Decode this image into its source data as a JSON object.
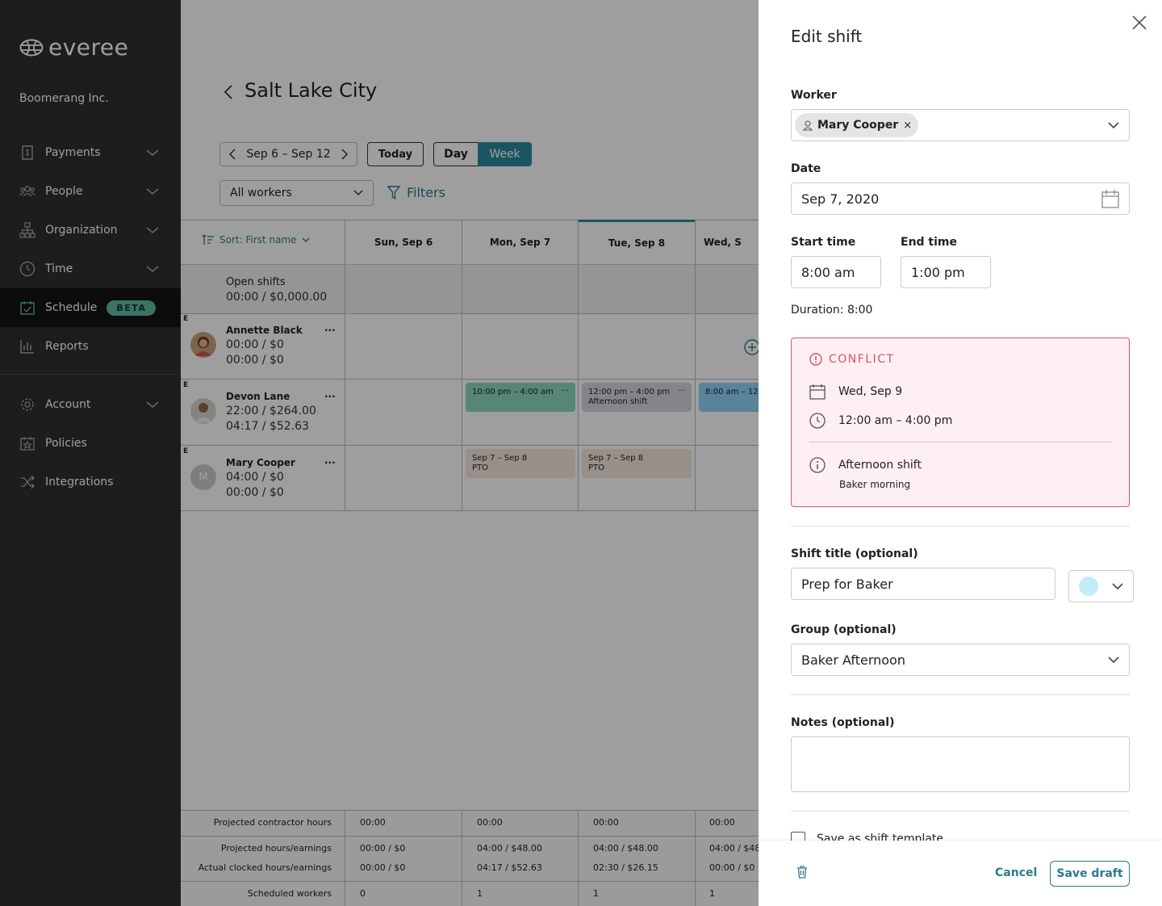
{
  "brand": {
    "name": "everee"
  },
  "sidebar": {
    "company": "Boomerang Inc.",
    "items": [
      {
        "label": "Payments",
        "icon": "receipt-icon"
      },
      {
        "label": "People",
        "icon": "people-icon"
      },
      {
        "label": "Organization",
        "icon": "org-chart-icon"
      },
      {
        "label": "Time",
        "icon": "clock-icon"
      },
      {
        "label": "Schedule",
        "icon": "calendar-check-icon",
        "badge": "BETA"
      },
      {
        "label": "Reports",
        "icon": "bar-chart-icon"
      },
      {
        "label": "Account",
        "icon": "gear-icon"
      },
      {
        "label": "Policies",
        "icon": "policy-icon"
      },
      {
        "label": "Integrations",
        "icon": "shuffle-icon"
      }
    ]
  },
  "page": {
    "title": "Salt Lake City",
    "date_range": "Sep 6 – Sep 12",
    "today": "Today",
    "day": "Day",
    "week": "Week",
    "workers_select": "All workers",
    "filters": "Filters",
    "sort": "Sort: First name"
  },
  "schedule": {
    "days": [
      "Sun, Sep 6",
      "Mon, Sep 7",
      "Tue, Sep 8",
      "Wed, S"
    ],
    "open_shifts": {
      "label": "Open shifts",
      "value": "00:00 / $0,000.00"
    },
    "rows": [
      {
        "tag": "E",
        "name": "Annette Black",
        "line1": "00:00 / $0",
        "line2": "00:00 / $0",
        "menu": "···"
      },
      {
        "tag": "E",
        "name": "Devon Lane",
        "line1": "22:00 / $264.00",
        "line2": "04:17 / $52.63",
        "menu": "···"
      },
      {
        "tag": "E",
        "name": "Mary Cooper",
        "line1": "04:00 / $0",
        "line2": "00:00 / $0",
        "menu": "···",
        "initial": "M"
      }
    ],
    "shifts": [
      {
        "text": "10:00 pm – 4:00 am",
        "sub": "",
        "menu": "···",
        "color": "#8ad9c1"
      },
      {
        "text": "12:00 pm – 4:00 pm",
        "sub": "Afternoon shift",
        "menu": "···",
        "color": "#d8d6e0"
      },
      {
        "text": "8:00 am – 12:",
        "sub": "",
        "menu": "",
        "color": "#8fd3f5"
      },
      {
        "text": "Sep 7 – Sep 8",
        "sub": "PTO",
        "menu": "",
        "color": "#f6e8dc"
      },
      {
        "text": "Sep 7 – Sep 8",
        "sub": "PTO",
        "menu": "",
        "color": "#f6e8dc"
      }
    ],
    "footer": {
      "projected_contractor": {
        "label": "Projected contractor hours",
        "values": [
          "00:00",
          "00:00",
          "00:00",
          "00:00"
        ]
      },
      "projected": {
        "label": "Projected hours/earnings",
        "values": [
          "00:00 / $0",
          "04:00 / $48.00",
          "04:00 / $48.00",
          "04:00 / $48"
        ]
      },
      "actual": {
        "label": "Actual clocked hours/earnings",
        "values": [
          "00:00 / $0",
          "04:17 / $52.63",
          "02:30 / $26.15",
          "00:00 / $0"
        ]
      },
      "scheduled": {
        "label": "Scheduled workers",
        "values": [
          "0",
          "1",
          "1",
          "1"
        ]
      }
    }
  },
  "panel": {
    "title": "Edit shift",
    "worker_label": "Worker",
    "worker_value": "Mary Cooper",
    "date_label": "Date",
    "date_value": "Sep 7, 2020",
    "start_label": "Start time",
    "start_value": "8:00 am",
    "end_label": "End time",
    "end_value": "1:00 pm",
    "duration": "Duration: 8:00",
    "conflict": {
      "heading": "CONFLICT",
      "date": "Wed, Sep 9",
      "time": "12:00 am – 4:00 pm",
      "title": "Afternoon shift",
      "subtitle": "Baker morning"
    },
    "shift_title_label": "Shift title (optional)",
    "shift_title_value": "Prep for Baker",
    "shift_color": "#c4ecf9",
    "group_label": "Group (optional)",
    "group_value": "Baker Afternoon",
    "notes_label": "Notes (optional)",
    "template_label": "Save as shift template",
    "cancel": "Cancel",
    "save": "Save draft"
  }
}
